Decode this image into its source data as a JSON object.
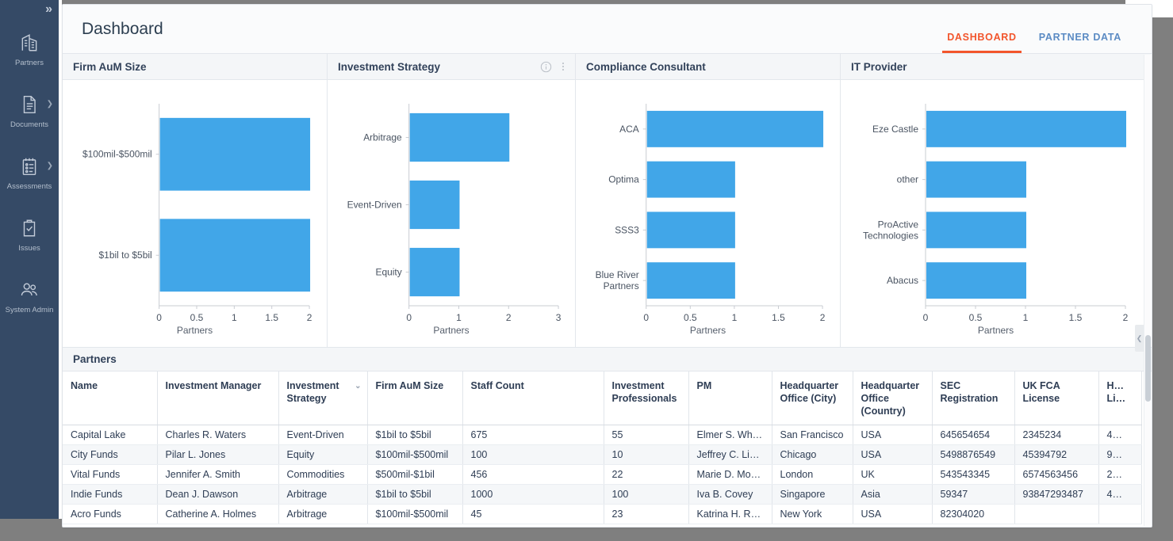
{
  "sidebar": {
    "expand_label": "»",
    "items": [
      {
        "label": "Partners",
        "icon": "building-icon",
        "has_caret": false
      },
      {
        "label": "Documents",
        "icon": "document-icon",
        "has_caret": true
      },
      {
        "label": "Assessments",
        "icon": "checklist-icon",
        "has_caret": true
      },
      {
        "label": "Issues",
        "icon": "clipboard-check-icon",
        "has_caret": false
      },
      {
        "label": "System Admin",
        "icon": "users-icon",
        "has_caret": false
      }
    ]
  },
  "header": {
    "title": "Dashboard",
    "tabs": [
      {
        "label": "DASHBOARD",
        "active": true
      },
      {
        "label": "PARTNER DATA",
        "active": false
      }
    ],
    "active_tab_color": "#f2552c",
    "inactive_tab_color": "#5b8bc4"
  },
  "chart_data": [
    {
      "type": "bar",
      "orientation": "horizontal",
      "title": "Firm AuM Size",
      "categories": [
        "$100mil-$500mil",
        "$1bil to $5bil"
      ],
      "values": [
        2,
        2
      ],
      "xlabel": "Partners",
      "ylabel": "",
      "xlim": [
        0,
        2
      ],
      "xticks": [
        "0",
        "0.5",
        "1",
        "1.5",
        "2"
      ],
      "grid": false,
      "bar_color": "#41a6e8",
      "has_info_icon": false,
      "has_menu_icon": false
    },
    {
      "type": "bar",
      "orientation": "horizontal",
      "title": "Investment Strategy",
      "categories": [
        "Arbitrage",
        "Event-Driven",
        "Equity"
      ],
      "values": [
        2,
        1,
        1
      ],
      "xlabel": "Partners",
      "ylabel": "",
      "xlim": [
        0,
        3
      ],
      "xticks": [
        "0",
        "1",
        "2",
        "3"
      ],
      "grid": false,
      "bar_color": "#41a6e8",
      "has_info_icon": true,
      "has_menu_icon": true
    },
    {
      "type": "bar",
      "orientation": "horizontal",
      "title": "Compliance Consultant",
      "categories": [
        "ACA",
        "Optima",
        "SSS3",
        "Blue River Partners"
      ],
      "values": [
        2,
        1,
        1,
        1
      ],
      "xlabel": "Partners",
      "ylabel": "",
      "xlim": [
        0,
        2
      ],
      "xticks": [
        "0",
        "0.5",
        "1",
        "1.5",
        "2"
      ],
      "grid": false,
      "bar_color": "#41a6e8",
      "has_info_icon": false,
      "has_menu_icon": false
    },
    {
      "type": "bar",
      "orientation": "horizontal",
      "title": "IT Provider",
      "categories": [
        "Eze Castle",
        "other",
        "ProActive Technologies",
        "Abacus"
      ],
      "values": [
        2,
        1,
        1,
        1
      ],
      "xlabel": "Partners",
      "ylabel": "",
      "xlim": [
        0,
        2
      ],
      "xticks": [
        "0",
        "0.5",
        "1",
        "1.5",
        "2"
      ],
      "grid": false,
      "bar_color": "#41a6e8",
      "has_info_icon": false,
      "has_menu_icon": false
    }
  ],
  "table": {
    "section_title": "Partners",
    "sorted_column": "Investment Strategy",
    "columns": [
      "Name",
      "Investment Manager",
      "Investment Strategy",
      "Firm AuM Size",
      "Staff Count",
      "Investment Professionals",
      "PM",
      "Headquarter Office (City)",
      "Headquarter Office (Country)",
      "SEC Registration",
      "UK FCA License",
      "H… Li…"
    ],
    "rows": [
      [
        "Capital Lake",
        "Charles R. Waters",
        "Event-Driven",
        "$1bil to $5bil",
        "675",
        "55",
        "Elmer S. Whi…",
        "San Francisco",
        "USA",
        "645654654",
        "2345234",
        "4…"
      ],
      [
        "City Funds",
        "Pilar L. Jones",
        "Equity",
        "$100mil-$500mil",
        "100",
        "10",
        "Jeffrey C. Lin…",
        "Chicago",
        "USA",
        "5498876549",
        "45394792",
        "9…"
      ],
      [
        "Vital Funds",
        "Jennifer A. Smith",
        "Commodities",
        "$500mil-$1bil",
        "456",
        "22",
        "Marie D. Mo…",
        "London",
        "UK",
        "543543345",
        "6574563456",
        "2…"
      ],
      [
        "Indie Funds",
        "Dean J. Dawson",
        "Arbitrage",
        "$1bil to $5bil",
        "1000",
        "100",
        "Iva B. Covey",
        "Singapore",
        "Asia",
        "59347",
        "93847293487",
        "4…"
      ],
      [
        "Acro Funds",
        "Catherine A. Holmes",
        "Arbitrage",
        "$100mil-$500mil",
        "45",
        "23",
        "Katrina H. R…",
        "New York",
        "USA",
        "82304020",
        "",
        ""
      ]
    ]
  }
}
